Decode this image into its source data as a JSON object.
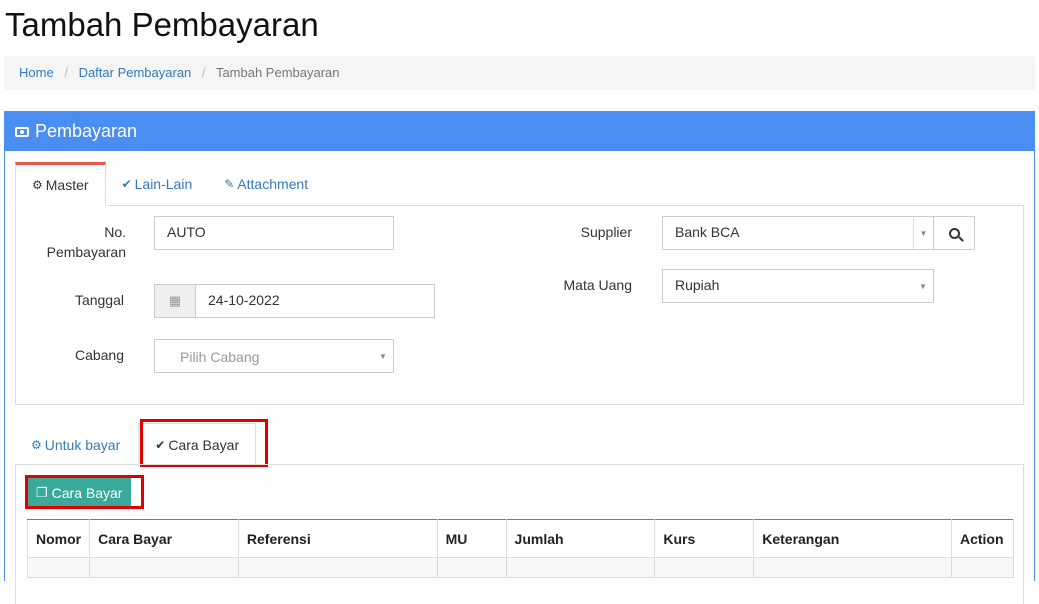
{
  "page": {
    "title": "Tambah Pembayaran"
  },
  "breadcrumb": {
    "items": [
      "Home",
      "Daftar Pembayaran"
    ],
    "current": "Tambah Pembayaran"
  },
  "panel": {
    "title": "Pembayaran",
    "icon": "money-icon"
  },
  "top_tabs": [
    {
      "label": "Master",
      "icon": "cogs-icon",
      "active": true
    },
    {
      "label": "Lain-Lain",
      "icon": "check-circle-icon",
      "active": false
    },
    {
      "label": "Attachment",
      "icon": "paperclip-icon",
      "active": false
    }
  ],
  "form": {
    "no_pembayaran": {
      "label_line1": "No.",
      "label_line2": "Pembayaran",
      "value": "AUTO"
    },
    "tanggal": {
      "label": "Tanggal",
      "value": "24-10-2022"
    },
    "cabang": {
      "label": "Cabang",
      "placeholder": "Pilih Cabang"
    },
    "supplier": {
      "label": "Supplier",
      "value": "Bank BCA"
    },
    "mata_uang": {
      "label": "Mata Uang",
      "value": "Rupiah"
    }
  },
  "bottom_tabs": [
    {
      "label": "Untuk bayar",
      "icon": "cogs-icon",
      "active": false
    },
    {
      "label": "Cara Bayar",
      "icon": "check-circle-icon",
      "active": true
    }
  ],
  "cara_bayar_button": {
    "label": "Cara Bayar",
    "icon": "copy-icon"
  },
  "table": {
    "columns": [
      "Nomor",
      "Cara Bayar",
      "Referensi",
      "MU",
      "Jumlah",
      "Kurs",
      "Keterangan",
      "Action"
    ]
  },
  "colors": {
    "primary": "#4a8ef1",
    "accent_tab": "#e8574c",
    "teal": "#3aa99c",
    "highlight": "#e00000",
    "link": "#337ab7"
  }
}
